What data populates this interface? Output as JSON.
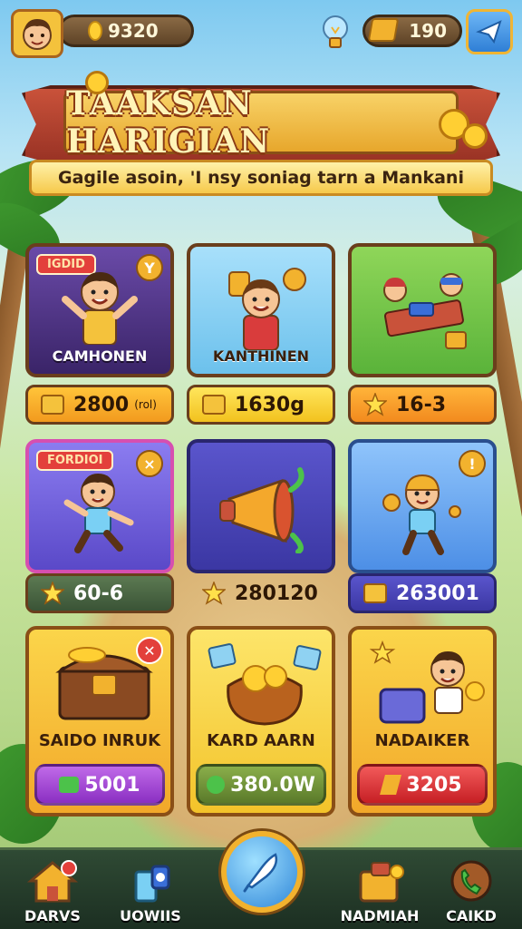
{
  "hud": {
    "coins": "9320",
    "gems": "190"
  },
  "banner": {
    "title": "TAAKSAN HARIGIAN",
    "subtitle": "Gagile asoin, 'I nsy soniag tarn a Mankani"
  },
  "cards": [
    {
      "label": "CAMHONEN",
      "tag": "IGDID",
      "corner": "Y",
      "price": "2800",
      "price_unit": "(rol)",
      "theme": "#5b3a8c"
    },
    {
      "label": "KANTHINEN",
      "tag": "",
      "corner": "",
      "price": "1630g",
      "price_unit": "",
      "theme": "#8fd2f2"
    },
    {
      "label": "",
      "tag": "",
      "corner": "",
      "price": "16-3",
      "price_unit": "",
      "theme": "#7ac943"
    },
    {
      "label": "",
      "tag": "FORDIOI",
      "corner": "×",
      "price": "60-6",
      "price_unit": "",
      "theme": "#6f64d8"
    },
    {
      "label": "",
      "tag": "",
      "corner": "",
      "price": "280120",
      "price_unit": "",
      "theme": "#4b47b8"
    },
    {
      "label": "",
      "tag": "",
      "corner": "!",
      "price": "263001",
      "price_unit": "",
      "theme": "#6fa8ee"
    }
  ],
  "bottom_cards": [
    {
      "label": "SAIDO INRUK",
      "button": "5001",
      "button_color": "#a246d6"
    },
    {
      "label": "KARD AARN",
      "button": "380.0W",
      "button_color": "#6a8f3a"
    },
    {
      "label": "NADAIKER",
      "button": "3205",
      "button_color": "#e2383c"
    }
  ],
  "nav": {
    "items": [
      "DARVS",
      "UOWIIS",
      "",
      "NADMIAH",
      "CAIKD"
    ]
  },
  "colors": {
    "accent": "#f2b22e",
    "ribbon": "#c9523a",
    "nav_bg": "#1c2f22"
  }
}
